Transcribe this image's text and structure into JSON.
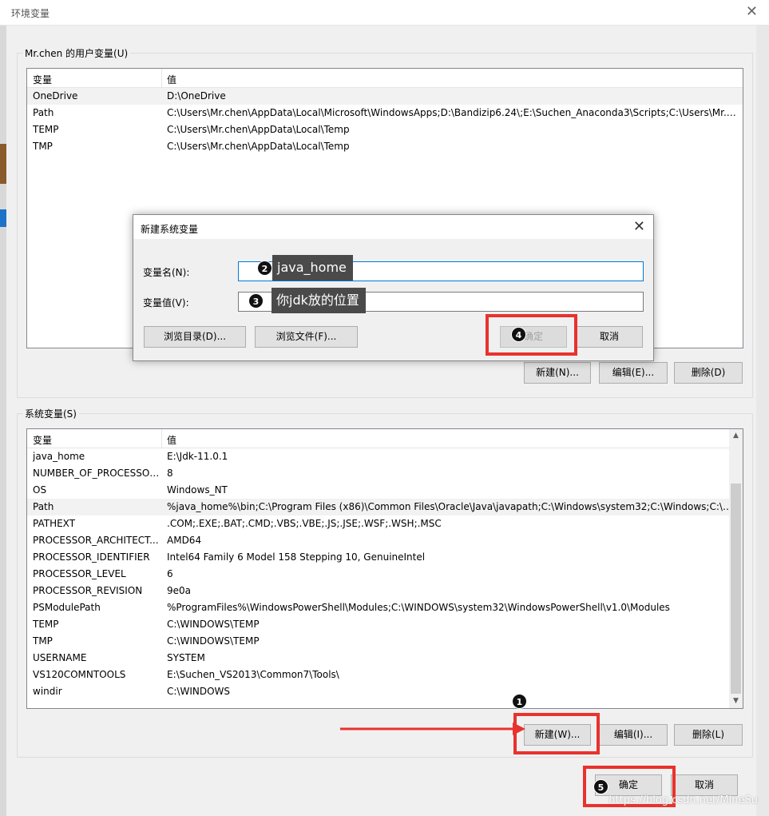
{
  "window": {
    "title": "环境变量",
    "close_icon": "✕"
  },
  "user_vars": {
    "group_label": "Mr.chen 的用户变量(U)",
    "col_var": "变量",
    "col_val": "值",
    "rows": [
      {
        "name": "OneDrive",
        "value": "D:\\OneDrive"
      },
      {
        "name": "Path",
        "value": "C:\\Users\\Mr.chen\\AppData\\Local\\Microsoft\\WindowsApps;D:\\Bandizip6.24\\;E:\\Suchen_Anaconda3\\Scripts;C:\\Users\\Mr.ch..."
      },
      {
        "name": "TEMP",
        "value": "C:\\Users\\Mr.chen\\AppData\\Local\\Temp"
      },
      {
        "name": "TMP",
        "value": "C:\\Users\\Mr.chen\\AppData\\Local\\Temp"
      }
    ],
    "buttons": {
      "new": "新建(N)...",
      "edit": "编辑(E)...",
      "delete": "删除(D)"
    }
  },
  "sys_vars": {
    "group_label": "系统变量(S)",
    "col_var": "变量",
    "col_val": "值",
    "rows": [
      {
        "name": "java_home",
        "value": "E:\\Jdk-11.0.1"
      },
      {
        "name": "NUMBER_OF_PROCESSORS",
        "value": "8"
      },
      {
        "name": "OS",
        "value": "Windows_NT"
      },
      {
        "name": "Path",
        "value": "%java_home%\\bin;C:\\Program Files (x86)\\Common Files\\Oracle\\Java\\javapath;C:\\Windows\\system32;C:\\Windows;C:\\Wi..."
      },
      {
        "name": "PATHEXT",
        "value": ".COM;.EXE;.BAT;.CMD;.VBS;.VBE;.JS;.JSE;.WSF;.WSH;.MSC"
      },
      {
        "name": "PROCESSOR_ARCHITECT...",
        "value": "AMD64"
      },
      {
        "name": "PROCESSOR_IDENTIFIER",
        "value": "Intel64 Family 6 Model 158 Stepping 10, GenuineIntel"
      },
      {
        "name": "PROCESSOR_LEVEL",
        "value": "6"
      },
      {
        "name": "PROCESSOR_REVISION",
        "value": "9e0a"
      },
      {
        "name": "PSModulePath",
        "value": "%ProgramFiles%\\WindowsPowerShell\\Modules;C:\\WINDOWS\\system32\\WindowsPowerShell\\v1.0\\Modules"
      },
      {
        "name": "TEMP",
        "value": "C:\\WINDOWS\\TEMP"
      },
      {
        "name": "TMP",
        "value": "C:\\WINDOWS\\TEMP"
      },
      {
        "name": "USERNAME",
        "value": "SYSTEM"
      },
      {
        "name": "VS120COMNTOOLS",
        "value": "E:\\Suchen_VS2013\\Common7\\Tools\\"
      },
      {
        "name": "windir",
        "value": "C:\\WINDOWS"
      }
    ],
    "buttons": {
      "new": "新建(W)...",
      "edit": "编辑(I)...",
      "delete": "删除(L)"
    }
  },
  "footer": {
    "ok": "确定",
    "cancel": "取消"
  },
  "dialog": {
    "title": "新建系统变量",
    "name_label": "变量名(N):",
    "value_label": "变量值(V):",
    "browse_dir": "浏览目录(D)...",
    "browse_file": "浏览文件(F)...",
    "ok": "确定",
    "cancel": "取消"
  },
  "annotations": {
    "step1": "1",
    "step2": "2",
    "step3": "3",
    "step4": "4",
    "step5": "5",
    "callout_name": "java_home",
    "callout_value": "你jdk放的位置",
    "highlight_color": "#e8322e"
  },
  "watermark": "https://blog.csdn.net/MineSu"
}
